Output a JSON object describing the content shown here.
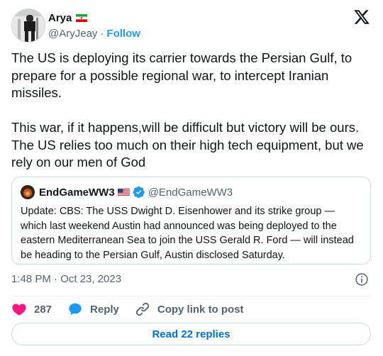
{
  "author": {
    "name": "Arya",
    "handle": "@AryJeay",
    "separator": "·",
    "follow_label": "Follow",
    "flag_icon": "iran-flag-icon"
  },
  "tweet": {
    "text": "The US is deploying its carrier towards the Persian Gulf, to prepare for a possible regional war, to intercept Iranian missiles.\n\nThis war, if it happens,will be difficult but victory will be ours. The US relies too much on their high tech equipment, but we rely on our men of God",
    "timestamp": "1:48 PM · Oct 23, 2023"
  },
  "quote": {
    "name": "EndGameWW3",
    "handle": "@EndGameWW3",
    "flag_icon": "us-flag-icon",
    "verified_icon": "verified-badge-icon",
    "text": "Update: CBS: The USS Dwight D. Eisenhower and its strike group — which last weekend Austin had announced was being deployed to the eastern Mediterranean Sea to join the USS Gerald R. Ford — will instead be heading to the Persian Gulf, Austin disclosed Saturday."
  },
  "actions": {
    "likes": "287",
    "reply_label": "Reply",
    "copy_label": "Copy link to post"
  },
  "read_replies_label": "Read 22 replies",
  "colors": {
    "accent": "#1d9bf0",
    "like": "#f91880",
    "muted": "#536471",
    "border": "#cfd9de"
  }
}
